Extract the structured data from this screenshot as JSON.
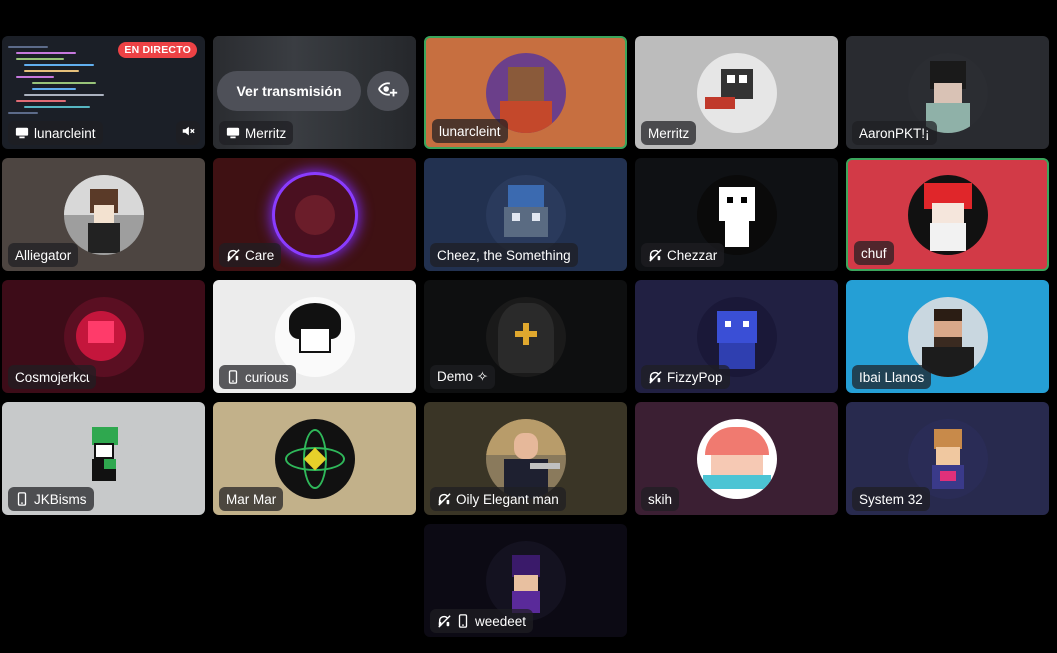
{
  "live_badge": "EN DIRECTO",
  "watch_button": "Ver transmisión",
  "tiles": [
    {
      "name": "lunarcleint",
      "icon": "screen",
      "background": "#1b1f27"
    },
    {
      "name": "Merritz",
      "icon": "screen",
      "background": "#2a2c30"
    },
    {
      "name": "lunarcleint",
      "icon": "none",
      "background": "#c76f40",
      "speaking": true
    },
    {
      "name": "Merritz",
      "icon": "none",
      "background": "#bcbcbc"
    },
    {
      "name": "AaronPKT!¡",
      "icon": "none",
      "background": "#292b30"
    },
    {
      "name": "Alliegator",
      "icon": "none",
      "background": "#4d4541"
    },
    {
      "name": "Care",
      "icon": "deafened",
      "background": "#3f1113"
    },
    {
      "name": "Cheez, the Something",
      "icon": "none",
      "background": "#223150"
    },
    {
      "name": "Chezzar",
      "icon": "deafened",
      "background": "#0f1114"
    },
    {
      "name": "chuf",
      "icon": "none",
      "background": "#d23a47",
      "speaking": true
    },
    {
      "name": "Cosmojerkcɩ",
      "icon": "none",
      "background": "#3d0c18"
    },
    {
      "name": "curious",
      "icon": "mobile",
      "background": "#ececec"
    },
    {
      "name": "Demo ✧",
      "icon": "none",
      "background": "#0e0f10"
    },
    {
      "name": "FizzyPop",
      "icon": "deafened",
      "background": "#212042"
    },
    {
      "name": "Ibai Llanos",
      "icon": "none",
      "background": "#259fd5"
    },
    {
      "name": "JKBisms",
      "icon": "mobile",
      "background": "#c7c9ca"
    },
    {
      "name": "Mar Mar",
      "icon": "none",
      "background": "#c2b18a"
    },
    {
      "name": "Oily Elegant man",
      "icon": "deafened",
      "background": "#3a3526"
    },
    {
      "name": "skih",
      "icon": "none",
      "background": "#3b1f33"
    },
    {
      "name": "System 32",
      "icon": "none",
      "background": "#282a4e"
    },
    {
      "name": "weedeet",
      "icon": "deafened-mobile",
      "background": "#0c0a14"
    }
  ]
}
